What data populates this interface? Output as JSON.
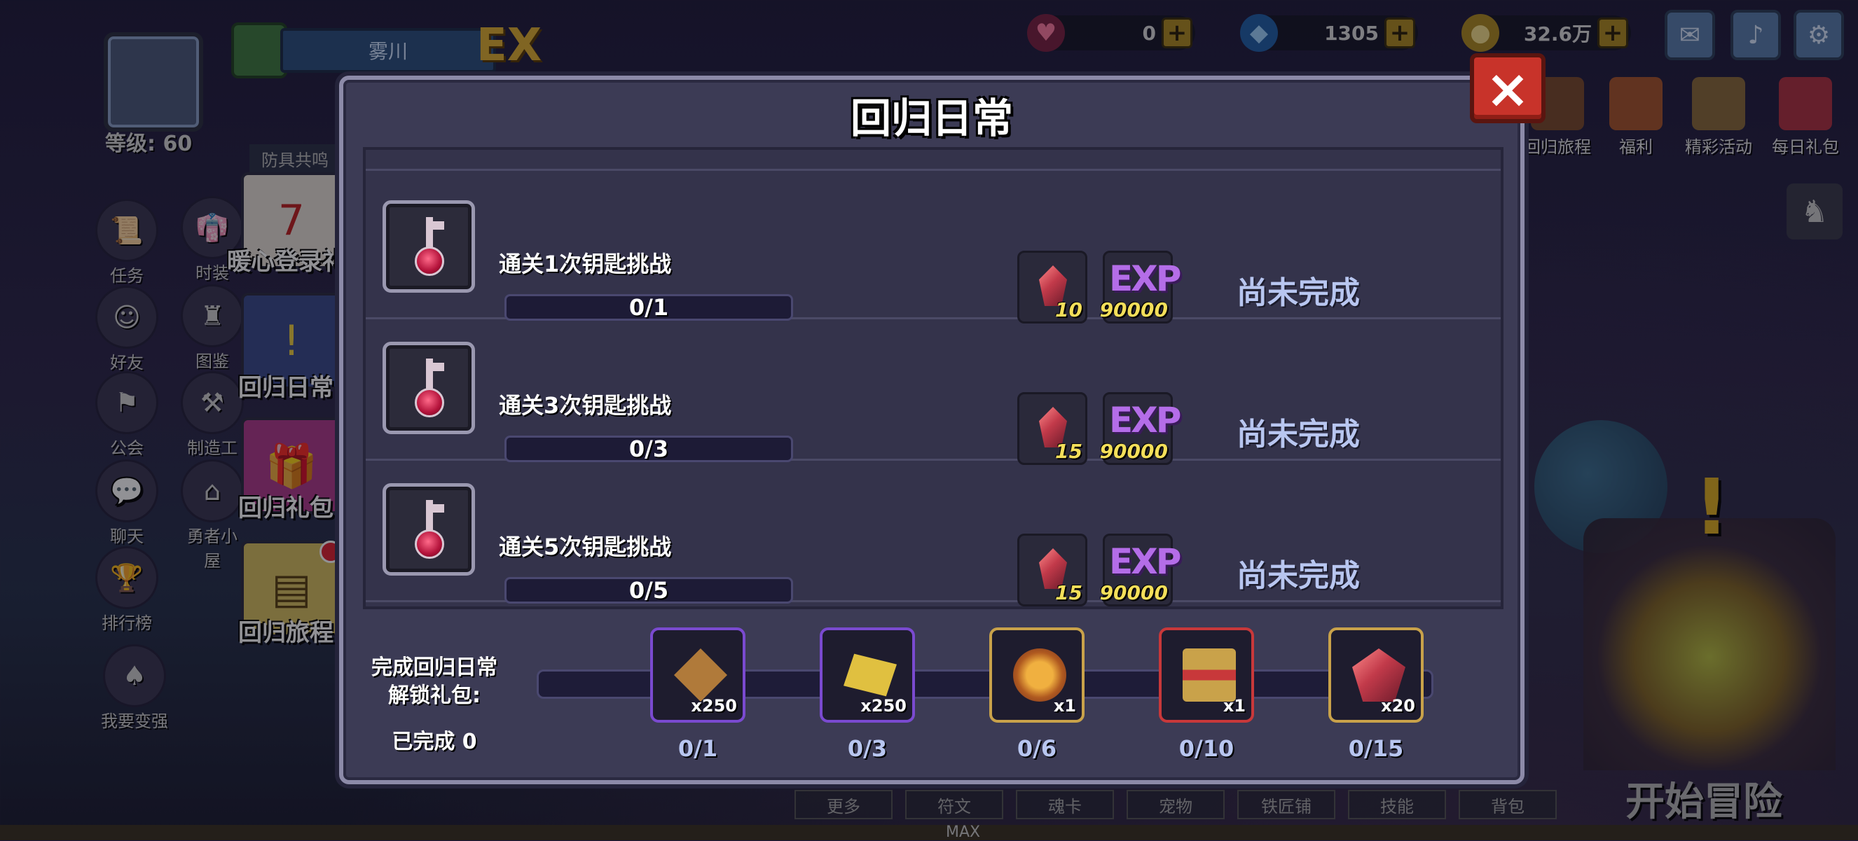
{
  "hud": {
    "level": "等级: 60",
    "player_name": "雾川",
    "ex_badge": "EX",
    "currencies": [
      {
        "icon": "heart-gem-icon",
        "value": "0"
      },
      {
        "icon": "blue-diamond-icon",
        "value": "1305"
      },
      {
        "icon": "gold-coin-icon",
        "value": "32.6万"
      }
    ],
    "plus_label": "+",
    "top_menu": [
      {
        "label": "回归旅程"
      },
      {
        "label": "福利"
      },
      {
        "label": "精彩活动"
      },
      {
        "label": "每日礼包"
      }
    ]
  },
  "left_menu": [
    {
      "label": "任务",
      "icon": "scroll-icon"
    },
    {
      "label": "时装",
      "icon": "robe-icon"
    },
    {
      "label": "好友",
      "icon": "friends-icon"
    },
    {
      "label": "图鉴",
      "icon": "castle-icon"
    },
    {
      "label": "公会",
      "icon": "banner-icon"
    },
    {
      "label": "制造工坊",
      "icon": "anvil-icon"
    },
    {
      "label": "聊天",
      "icon": "chat-icon"
    },
    {
      "label": "勇者小屋",
      "icon": "house-icon"
    },
    {
      "label": "排行榜",
      "icon": "trophy-icon"
    },
    {
      "label": "我要变强",
      "icon": "rabbit-icon"
    }
  ],
  "side_buttons": [
    {
      "label": "暖心登录礼",
      "icon": "calendar-icon"
    },
    {
      "label": "回归日常",
      "icon": "exclamation-scroll-icon"
    },
    {
      "label": "回归礼包",
      "icon": "gift-box-icon"
    },
    {
      "label": "回归旅程",
      "icon": "journey-scroll-icon"
    }
  ],
  "side_top_tab": "防具共鸣",
  "bottom_tabs": [
    "更多",
    "符文",
    "魂卡",
    "宠物",
    "铁匠铺",
    "技能",
    "背包"
  ],
  "bottom_max": "MAX",
  "start_button": "开始冒险",
  "modal": {
    "title": "回归日常",
    "close_label": "×",
    "tasks": [
      {
        "name": "通关1次钥匙挑战",
        "progress": "0/1",
        "rewards": [
          {
            "type": "gem",
            "count": "10"
          },
          {
            "type": "exp",
            "label": "EXP",
            "count": "90000"
          }
        ],
        "status": "尚未完成"
      },
      {
        "name": "通关3次钥匙挑战",
        "progress": "0/3",
        "rewards": [
          {
            "type": "gem",
            "count": "15"
          },
          {
            "type": "exp",
            "label": "EXP",
            "count": "90000"
          }
        ],
        "status": "尚未完成"
      },
      {
        "name": "通关5次钥匙挑战",
        "progress": "0/5",
        "rewards": [
          {
            "type": "gem",
            "count": "15"
          },
          {
            "type": "exp",
            "label": "EXP",
            "count": "90000"
          }
        ],
        "status": "尚未完成"
      }
    ],
    "unlock_label_line1": "完成回归日常",
    "unlock_label_line2": "解锁礼包:",
    "completed_label": "已完成 0",
    "milestones": [
      {
        "count": "x250",
        "progress": "0/1",
        "border": "#7a4ad0",
        "art": "bronze-rune-icon"
      },
      {
        "count": "x250",
        "progress": "0/3",
        "border": "#7a4ad0",
        "art": "gold-rune-icon"
      },
      {
        "count": "x1",
        "progress": "0/6",
        "border": "#c9a24a",
        "art": "gold-chest-icon"
      },
      {
        "count": "x1",
        "progress": "0/10",
        "border": "#c8383a",
        "art": "red-book-icon"
      },
      {
        "count": "x20",
        "progress": "0/15",
        "border": "#c9a24a",
        "art": "red-gem-icon"
      }
    ]
  }
}
